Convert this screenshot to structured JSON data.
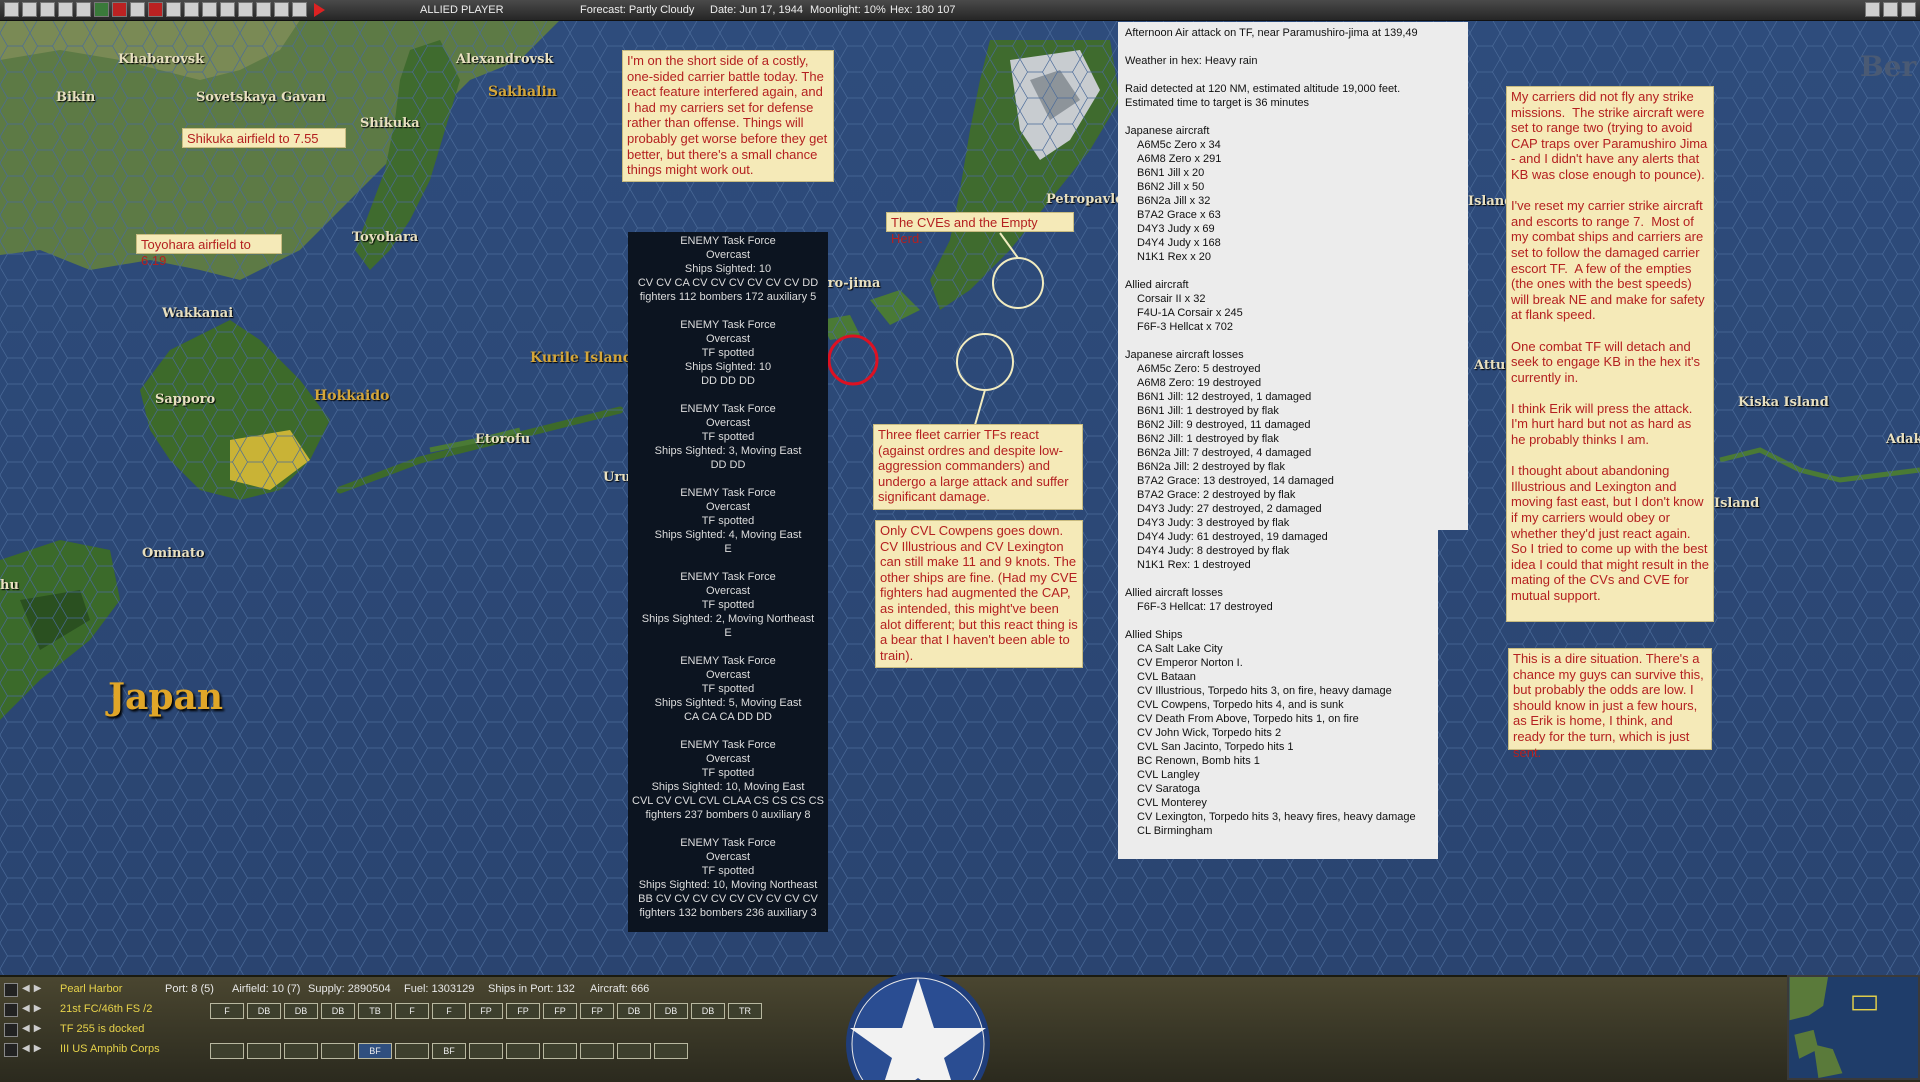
{
  "topbar": {
    "player": "ALLIED PLAYER",
    "forecast": "Forecast: Partly Cloudy",
    "date": "Date: Jun 17, 1944",
    "moonlight": "Moonlight: 10%",
    "hex": "Hex: 180 107"
  },
  "map": {
    "places": {
      "khabarovsk": "Khabarovsk",
      "alexandrovsk": "Alexandrovsk",
      "bikin": "Bikin",
      "sovetskaya": "Sovetskaya Gavan",
      "sakhalin": "Sakhalin",
      "shikuka": "Shikuka",
      "toyohara": "Toyohara",
      "wakkanai": "Wakkanai",
      "kurile": "Kurile Islands",
      "sapporo": "Sapporo",
      "hokkaido": "Hokkaido",
      "etorofu": "Etorofu",
      "uruppu": "Uruppu-jima",
      "ominato": "Ominato",
      "hu": "hu",
      "japan": "Japan",
      "petropavlovsk": "Petropavlov",
      "island1": "Island",
      "attu": "Attu",
      "kiska": "Kiska Island",
      "adak": "Adak",
      "island2": "Island",
      "ber": "Ber",
      "shirojima": "shiro-jima"
    }
  },
  "notes": {
    "shikuka_airfield": "Shikuka airfield to 7.55",
    "toyohara_airfield": "Toyohara airfield to 6.19",
    "short_side": "I'm on the short side of a costly, one-sided carrier battle today.  The react feature interfered again, and I had my carriers set for defense rather than offense.  Things will probably get worse before they get better, but there's a small chance things might work out.",
    "cves": "The CVEs and the Empty Herd.",
    "three_fleet": "Three fleet carrier TFs react (against ordres and despite low-aggression commanders) and undergo a large attack and suffer significant damage.",
    "cowpens": "Only CVL Cowpens goes down.  CV Illustrious and CV Lexington can still make 11 and 9 knots.  The other ships are fine.  (Had my CVE fighters had augmented the CAP, as intended, this might've been alot different; but this react thing is a bear that I haven't been able to train).",
    "strike": "My carriers did not fly any strike missions.  The strike aircraft were set to range two (trying to avoid CAP traps over Paramushiro Jima - and I didn't have any alerts that KB was close enough to pounce).\n\nI've reset my carrier strike aircraft and escorts to range 7.  Most of my combat ships and carriers are set to follow the damaged carrier escort TF.  A few of the empties (the ones with the best speeds) will break NE and make for safety at flank speed.\n\nOne combat TF will detach and seek to engage KB in the hex it's currently in.\n\nI think Erik will press the attack.  I'm hurt hard but not as hard as he probably thinks I am.\n\nI thought about abandoning Illustrious and Lexington and moving fast east, but I don't know if my carriers would obey or whether they'd just react again.  So I tried to come up with the best idea I could that might result in the mating of the CVs and CVE for mutual support.",
    "dire": "This is a dire situation.  There's a chance my guys can survive this, but probably the odds are low.  I should know in just a few hours, as Erik is home, I think, and ready for the turn, which is just sent."
  },
  "task_forces": [
    {
      "title": "ENEMY Task Force",
      "weather": "Overcast",
      "lines": [
        "Ships Sighted: 10",
        "CV CV CA CV CV CV CV CV CV DD",
        "fighters 112  bombers 172  auxiliary 5"
      ]
    },
    {
      "title": "ENEMY Task Force",
      "weather": "Overcast",
      "lines": [
        "TF spotted",
        "Ships Sighted: 10",
        "DD DD DD"
      ]
    },
    {
      "title": "ENEMY Task Force",
      "weather": "Overcast",
      "lines": [
        "TF spotted",
        "Ships Sighted: 3, Moving East",
        "DD DD"
      ]
    },
    {
      "title": "ENEMY Task Force",
      "weather": "Overcast",
      "lines": [
        "TF spotted",
        "Ships Sighted: 4, Moving East",
        "E"
      ]
    },
    {
      "title": "ENEMY Task Force",
      "weather": "Overcast",
      "lines": [
        "TF spotted",
        "Ships Sighted: 2, Moving Northeast",
        "E"
      ]
    },
    {
      "title": "ENEMY Task Force",
      "weather": "Overcast",
      "lines": [
        "TF spotted",
        "Ships Sighted: 5, Moving East",
        "CA CA CA DD DD"
      ]
    },
    {
      "title": "ENEMY Task Force",
      "weather": "Overcast",
      "lines": [
        "TF spotted",
        "Ships Sighted: 10, Moving East",
        "CVL CV CVL CVL CLAA CS CS CS CS",
        "fighters 237  bombers 0  auxiliary 8"
      ]
    },
    {
      "title": "ENEMY Task Force",
      "weather": "Overcast",
      "lines": [
        "TF spotted",
        "Ships Sighted: 10, Moving Northeast",
        "BB CV CV CV CV CV CV CV CV CV",
        "fighters 132  bombers 236  auxiliary 3"
      ]
    }
  ],
  "report": {
    "title": "Afternoon Air attack on TF, near Paramushiro-jima at 139,49",
    "weather": "Weather in hex: Heavy rain",
    "raid": "Raid detected at 120 NM, estimated altitude 19,000 feet.",
    "eta": "Estimated time to target is 36 minutes",
    "jp_aircraft_header": "Japanese aircraft",
    "jp_aircraft": [
      "A6M5c Zero x 34",
      "A6M8 Zero x 291",
      "B6N1 Jill x 20",
      "B6N2 Jill x 50",
      "B6N2a Jill x 32",
      "B7A2 Grace x 63",
      "D4Y3 Judy x 69",
      "D4Y4 Judy x 168",
      "N1K1 Rex x 20"
    ],
    "al_aircraft_header": "Allied aircraft",
    "al_aircraft": [
      "Corsair II x 32",
      "F4U-1A Corsair x 245",
      "F6F-3 Hellcat x 702"
    ],
    "jp_losses_header": "Japanese aircraft losses",
    "jp_losses": [
      "A6M5c Zero: 5 destroyed",
      "A6M8 Zero: 19 destroyed",
      "B6N1 Jill: 12 destroyed, 1 damaged",
      "B6N1 Jill: 1 destroyed by flak",
      "B6N2 Jill: 9 destroyed, 11 damaged",
      "B6N2 Jill: 1 destroyed by flak",
      "B6N2a Jill: 7 destroyed, 4 damaged",
      "B6N2a Jill: 2 destroyed by flak",
      "B7A2 Grace: 13 destroyed, 14 damaged",
      "B7A2 Grace: 2 destroyed by flak",
      "D4Y3 Judy: 27 destroyed, 2 damaged",
      "D4Y3 Judy: 3 destroyed by flak",
      "D4Y4 Judy: 61 destroyed, 19 damaged",
      "D4Y4 Judy: 8 destroyed by flak",
      "N1K1 Rex: 1 destroyed"
    ],
    "al_losses_header": "Allied aircraft losses",
    "al_losses": [
      "F6F-3 Hellcat: 17 destroyed"
    ],
    "ships_header": "Allied Ships",
    "ships": [
      "CA Salt Lake City",
      "CV Emperor Norton I.",
      "CVL Bataan",
      "CV Illustrious, Torpedo hits 3,  on fire,  heavy damage",
      "CVL Cowpens, Torpedo hits 4, and is sunk",
      "CV Death From Above, Torpedo hits 1,  on fire",
      "CV John Wick, Torpedo hits 2",
      "CVL San Jacinto, Torpedo hits 1",
      "BC Renown, Bomb hits 1",
      "CVL Langley",
      "CV Saratoga",
      "CVL Monterey",
      "CV Lexington, Torpedo hits 3,  heavy fires,  heavy damage",
      "CL Birmingham"
    ]
  },
  "bottombar": {
    "row1": {
      "location": "Pearl Harbor",
      "port": "Port: 8 (5)",
      "airfield": "Airfield: 10 (7)",
      "supply": "Supply: 2890504",
      "fuel": "Fuel: 1303129",
      "ships": "Ships in Port: 132",
      "aircraft": "Aircraft: 666"
    },
    "row2": {
      "unit": "21st FC/46th FS /2"
    },
    "row3": {
      "unit": "TF 255 is docked"
    },
    "row4": {
      "unit": "III US Amphib Corps"
    },
    "air_buttons": [
      "F",
      "DB",
      "DB",
      "DB",
      "TB",
      "F",
      "F",
      "FP",
      "FP",
      "FP",
      "FP",
      "DB",
      "DB",
      "DB",
      "TR"
    ],
    "unit_buttons": [
      "",
      "",
      "",
      "",
      "BF",
      "",
      "BF",
      "",
      "",
      "",
      "",
      "",
      ""
    ]
  },
  "colors": {
    "ocean": "#2d4a78",
    "note_bg": "#f5eab8",
    "note_text": "#b42020",
    "land": "#3b6b2a"
  }
}
